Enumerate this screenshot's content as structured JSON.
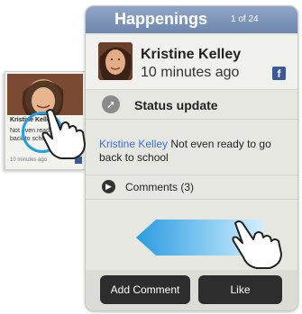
{
  "header": {
    "title": "Happenings",
    "count": "1 of 24"
  },
  "post": {
    "author": "Kristine Kelley",
    "time": "10 minutes ago",
    "type_label": "Status update",
    "body_author": "Kristine Kelley",
    "body_text": "Not even ready to go back to school",
    "comments_label": "Comments (3)"
  },
  "buttons": {
    "add_comment": "Add Comment",
    "like": "Like"
  },
  "mini_card": {
    "name": "Kristine Kelley",
    "text": "Not even ready to go back to school",
    "time": "10 minutes ago"
  },
  "icons": {
    "facebook": "f",
    "status": "arrow-up-right",
    "comments": "play"
  },
  "colors": {
    "header": "#7b91b8",
    "link": "#3b6fd1",
    "facebook": "#3b5998",
    "swipe_arrow": "#4aaee6",
    "touch_ring": "#22a0e0"
  }
}
